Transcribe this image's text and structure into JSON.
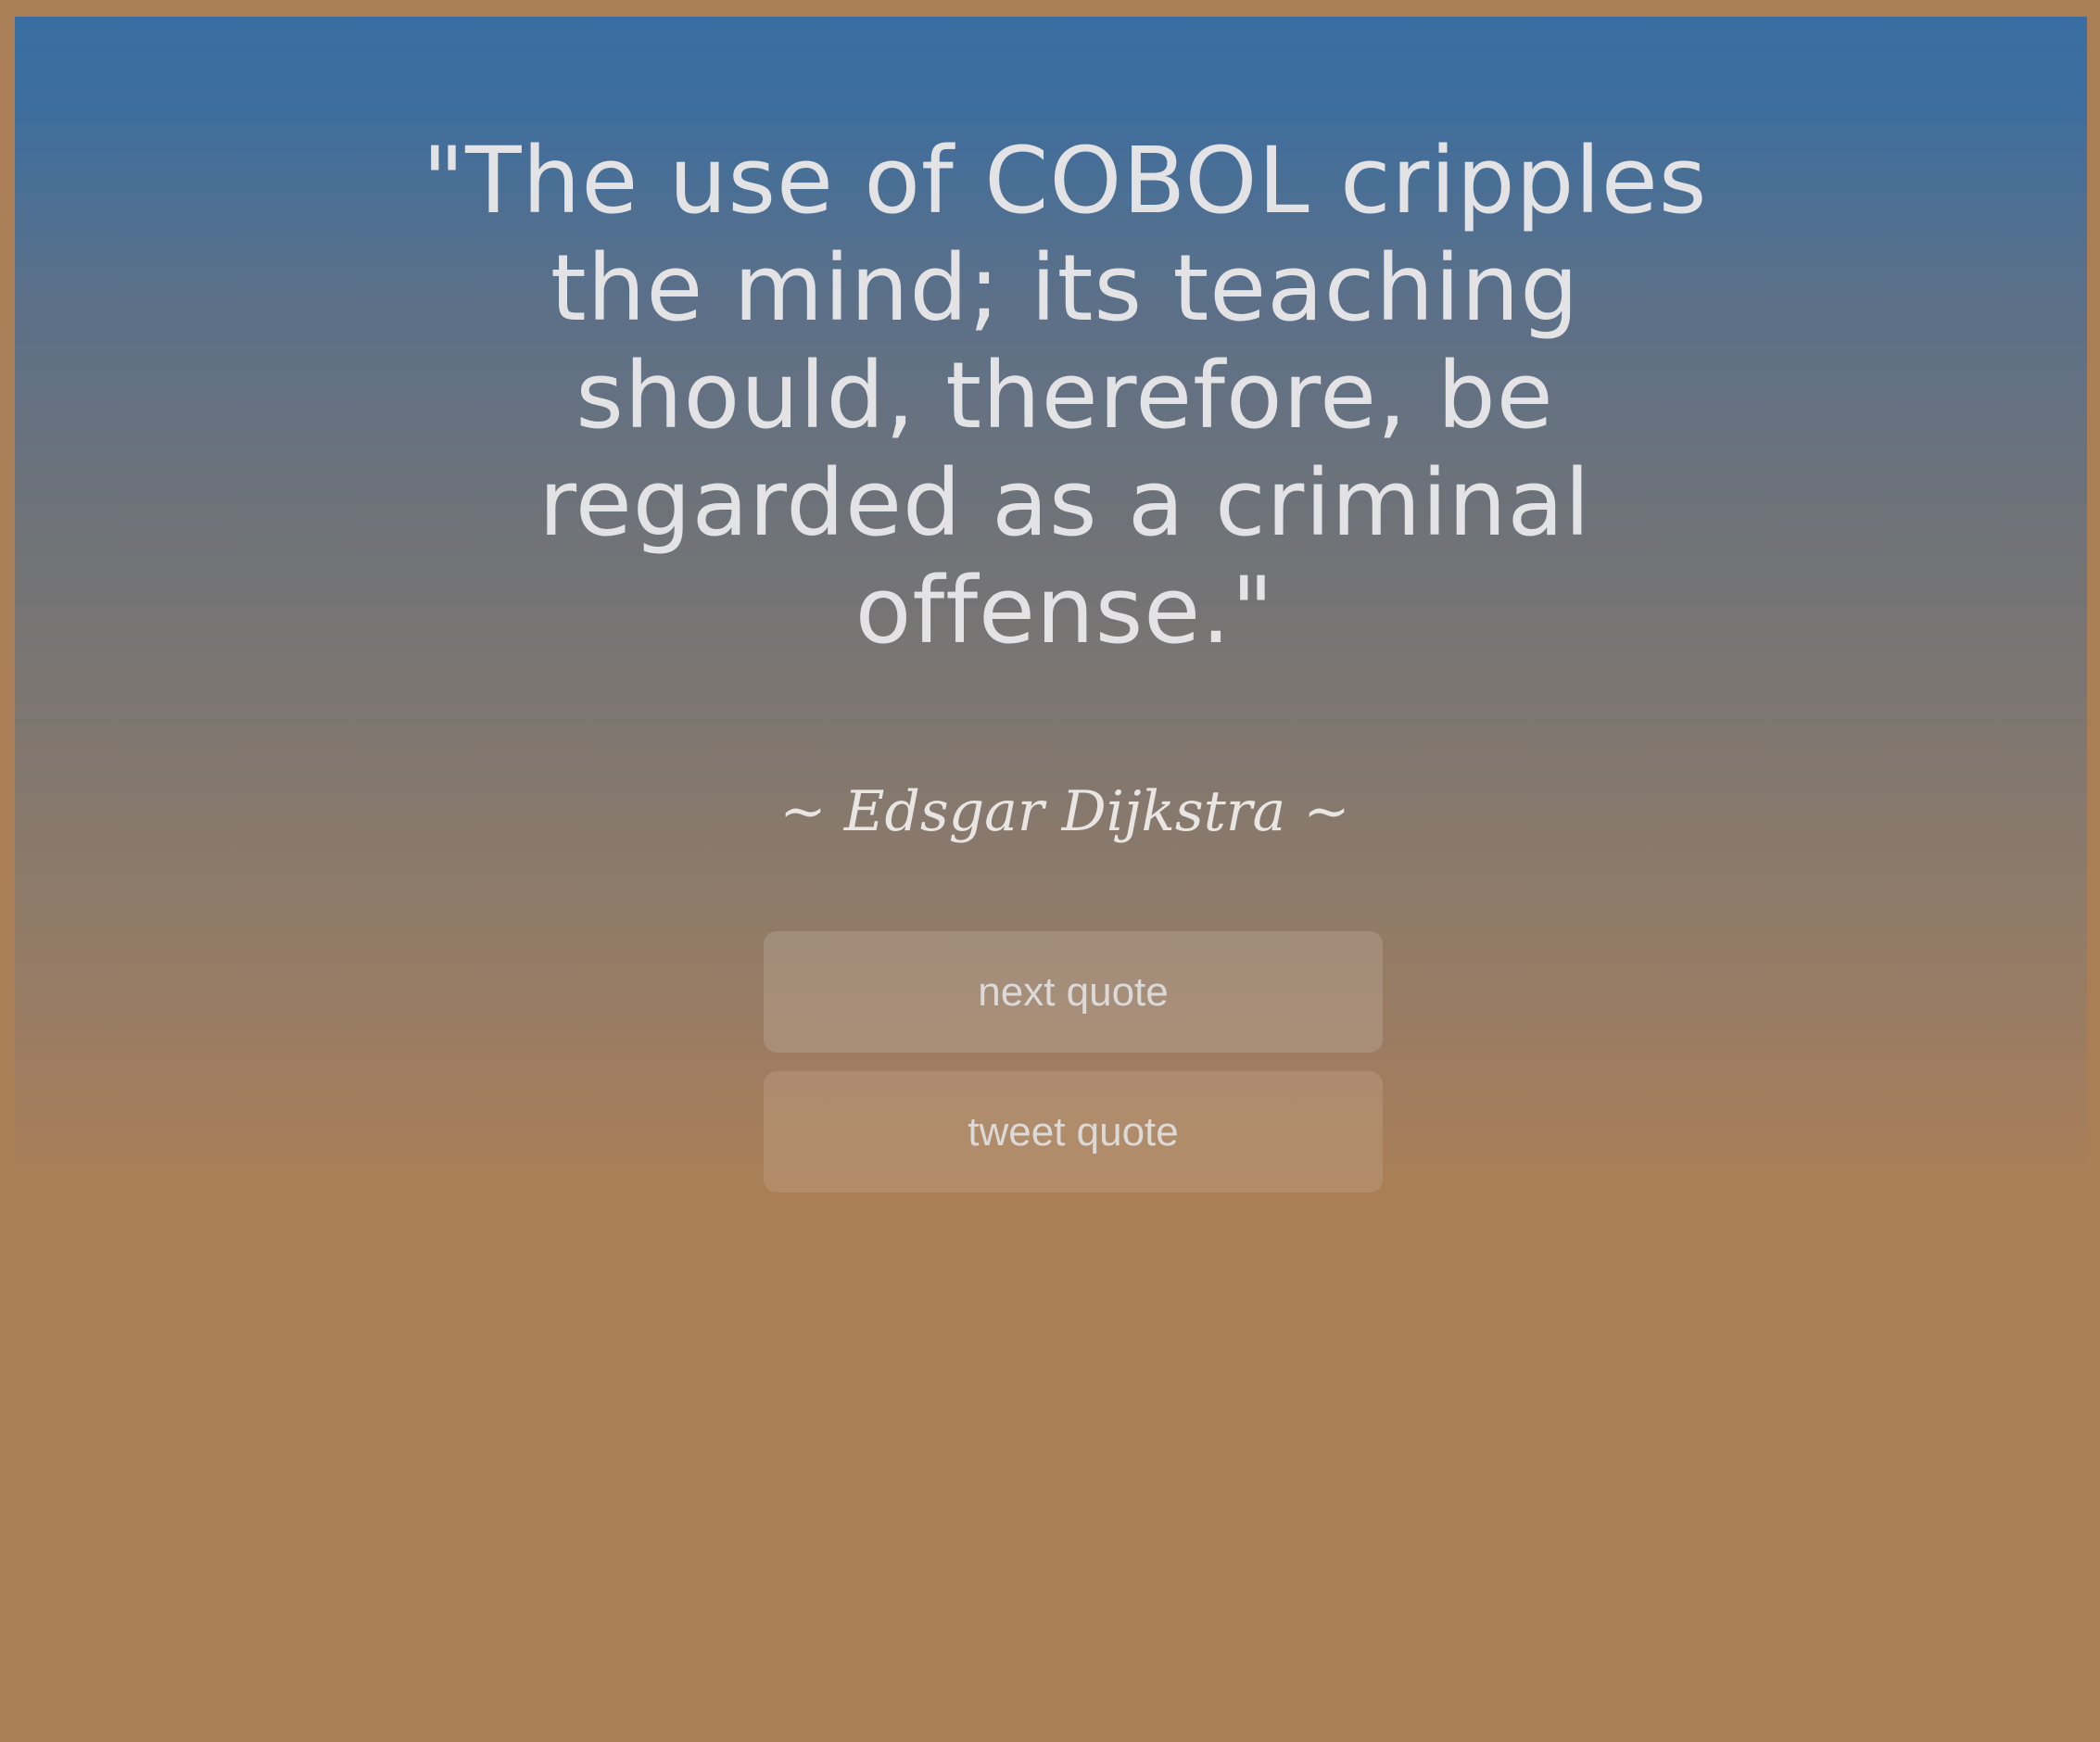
{
  "quote": {
    "text": "\"The use of COBOL cripples the mind; its teaching should, therefore, be regarded as a criminal offense.\"",
    "author": "~ Edsgar Dijkstra ~"
  },
  "buttons": {
    "next_label": "next quote",
    "tweet_label": "tweet quote"
  },
  "colors": {
    "gradient_top": "#3a6ea2",
    "gradient_bottom": "#aa7f57",
    "text": "#e3e3e5"
  }
}
